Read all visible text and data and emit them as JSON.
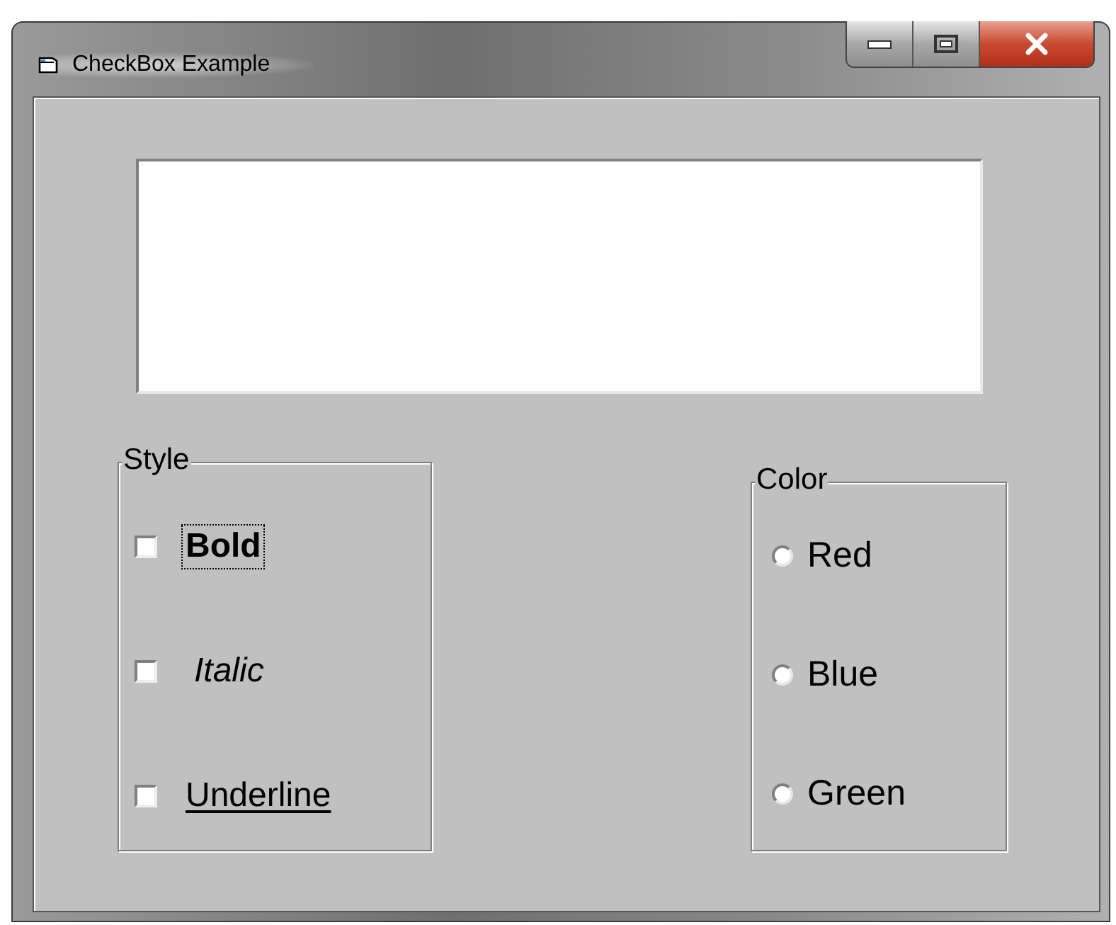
{
  "window": {
    "title": "CheckBox Example"
  },
  "style_group": {
    "label": "Style",
    "items": [
      {
        "kind": "bold",
        "label": "Bold",
        "checked": false,
        "focused": true
      },
      {
        "kind": "italic",
        "label": "Italic",
        "checked": false,
        "focused": false
      },
      {
        "kind": "underline",
        "label": "Underline",
        "checked": false,
        "focused": false
      }
    ]
  },
  "color_group": {
    "label": "Color",
    "items": [
      {
        "label": "Red",
        "selected": false
      },
      {
        "label": "Blue",
        "selected": false
      },
      {
        "label": "Green",
        "selected": false
      }
    ]
  }
}
